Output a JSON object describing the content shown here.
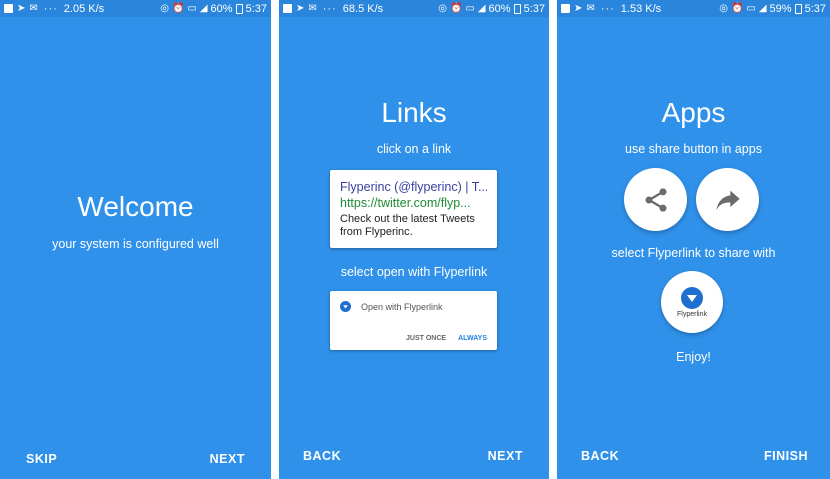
{
  "screens": [
    {
      "status": {
        "speed": "2.05 K/s",
        "battery": "60%",
        "time": "5:37"
      },
      "title": "Welcome",
      "subtitle": "your system is configured well",
      "left_button": "SKIP",
      "right_button": "NEXT"
    },
    {
      "status": {
        "speed": "68.5 K/s",
        "battery": "60%",
        "time": "5:37"
      },
      "title": "Links",
      "subtitle": "click on a link",
      "link_card": {
        "title": "Flyperinc (@flyperinc) | T...",
        "url": "https://twitter.com/flyp...",
        "description": "Check out the latest Tweets from Flyperinc."
      },
      "caption": "select open with Flyperlink",
      "dialog": {
        "text": "Open with Flyperlink",
        "just_once": "JUST ONCE",
        "always": "ALWAYS"
      },
      "left_button": "BACK",
      "right_button": "NEXT"
    },
    {
      "status": {
        "speed": "1.53 K/s",
        "battery": "59%",
        "time": "5:37"
      },
      "title": "Apps",
      "subtitle": "use share button in apps",
      "caption": "select Flyperlink to share with",
      "app_label": "Flyperlink",
      "enjoy": "Enjoy!",
      "left_button": "BACK",
      "right_button": "FINISH"
    }
  ],
  "colors": {
    "background": "#2f91ea",
    "statusbar": "#2a86dc",
    "link_title": "#3a3fa0",
    "link_url": "#1f8b35",
    "accent": "#1e7ee0"
  },
  "icons": [
    "facebook-icon",
    "send-icon",
    "mail-icon",
    "hotspot-icon",
    "alarm-icon",
    "volte-icon",
    "signal-icon",
    "battery-icon",
    "share-icon",
    "forward-icon",
    "flyperlink-logo-icon"
  ]
}
